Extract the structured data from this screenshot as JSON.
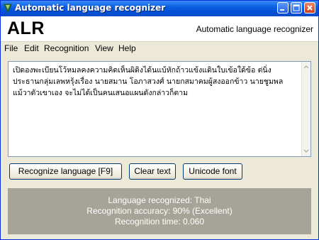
{
  "window": {
    "title": "Automatic language recognizer"
  },
  "titlebar_icons": [
    "app-icon",
    "minimize-icon",
    "maximize-icon",
    "close-icon"
  ],
  "header": {
    "brand": "ALR",
    "subtitle": "Automatic language recognizer"
  },
  "menu": [
    "File",
    "Edit",
    "Recognition",
    "View",
    "Help"
  ],
  "input": {
    "text": "เปิดองพะเบียนโว้หมลคงความคิดเห็นผิดิงได้นแบ้หักถ้าวแข้งแดินใบเข้อใด้ข้อ ต่นิ่ง\nประธานกลุ่มเลพหรุ้งเรื่อง นายสมาน โอภาสวงศ์ นายกสมาคมผู้สงออกข้าว นายชูมพล\nแม้วาตัวเขาเอง จะไม่ได้เป็นคนเสนอแผนดังกล่าวก็ตาม"
  },
  "buttons": {
    "recognize": "Recognize language   [F9]",
    "clear": "Clear text",
    "unicode": "Unicode font"
  },
  "result": {
    "language": "Language recognized: Thai",
    "accuracy": "Recognition accuracy: 90% (Excellent)",
    "time": "Recognition time: 0.060"
  },
  "colors": {
    "titlebar": "#0a5fe0",
    "result_bg": "#a6a398",
    "window_bg": "#ece9d8"
  }
}
